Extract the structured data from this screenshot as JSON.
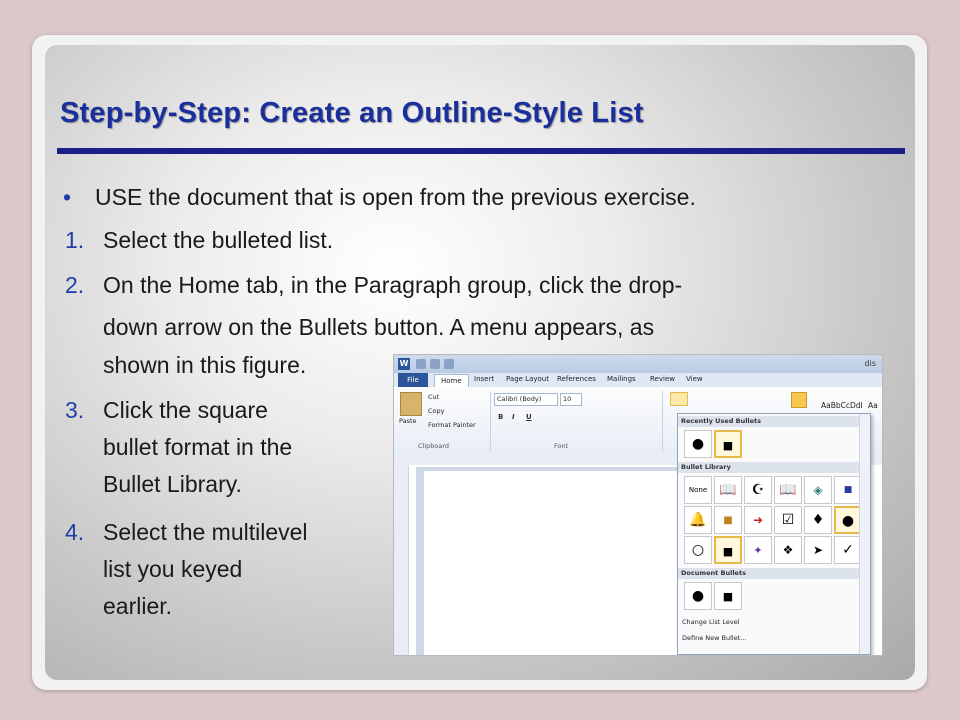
{
  "slide": {
    "title": "Step-by-Step: Create an Outline-Style List",
    "bullet_point": "USE the document that is open from the previous exercise.",
    "steps": [
      {
        "num": "1.",
        "lines": [
          "Select the bulleted list."
        ]
      },
      {
        "num": "2.",
        "lines": [
          "On the Home tab, in the Paragraph group, click the drop-",
          "down arrow on the Bullets button. A menu appears, as",
          "shown in this figure."
        ]
      },
      {
        "num": "3.",
        "lines": [
          "Click the square",
          "bullet format in the",
          "Bullet Library."
        ]
      },
      {
        "num": "4.",
        "lines": [
          "Select the multilevel",
          "list you keyed",
          "earlier."
        ]
      }
    ]
  },
  "word": {
    "title_fragment": "dis",
    "tabs": [
      "File",
      "Home",
      "Insert",
      "Page Layout",
      "References",
      "Mailings",
      "Review",
      "View"
    ],
    "clipboard": {
      "paste": "Paste",
      "cut": "Cut",
      "copy": "Copy",
      "format_painter": "Format Painter",
      "label": "Clipboard"
    },
    "font": {
      "name": "Calibri (Body)",
      "size": "10",
      "label": "Font",
      "bold": "B",
      "italic": "I",
      "underline": "U"
    },
    "style_preview": "AaBbCcDdI",
    "style_preview2": "Aa",
    "bullets_menu": {
      "recent_header": "Recently Used Bullets",
      "library_header": "Bullet Library",
      "document_header": "Document Bullets",
      "none_label": "None",
      "change_level": "Change List Level",
      "define_new": "Define New Bullet..."
    }
  }
}
